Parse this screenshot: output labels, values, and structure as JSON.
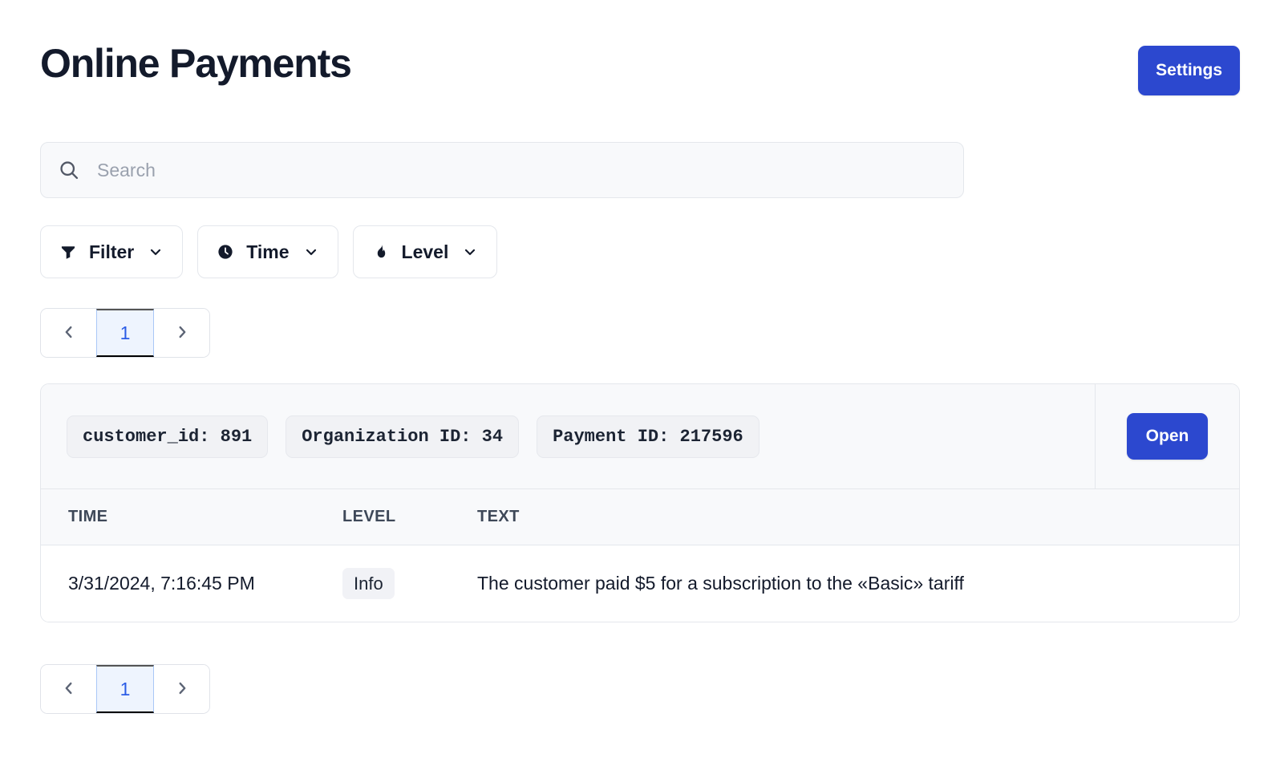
{
  "header": {
    "title": "Online Payments",
    "settings_label": "Settings",
    "accent_color": "#2c48cf"
  },
  "search": {
    "placeholder": "Search",
    "value": "",
    "icon": "search-icon"
  },
  "filters": [
    {
      "label": "Filter",
      "icon": "funnel-icon",
      "caret": "chevron-down-icon"
    },
    {
      "label": "Time",
      "icon": "clock-icon",
      "caret": "chevron-down-icon"
    },
    {
      "label": "Level",
      "icon": "flame-icon",
      "caret": "chevron-down-icon"
    }
  ],
  "pagination": {
    "prev_icon": "chevron-left-icon",
    "next_icon": "chevron-right-icon",
    "current_page": "1",
    "active_color": "#2b5ce6",
    "active_background": "#eef4fe"
  },
  "log_card": {
    "tags": [
      "customer_id: 891",
      "Organization ID: 34",
      "Payment ID: 217596"
    ],
    "open_label": "Open",
    "columns": [
      "TIME",
      "LEVEL",
      "TEXT"
    ],
    "rows": [
      {
        "time": "3/31/2024, 7:16:45 PM",
        "level": "Info",
        "text": "The customer paid $5 for a subscription to the «Basic» tariff"
      }
    ]
  }
}
